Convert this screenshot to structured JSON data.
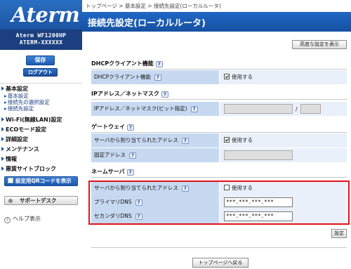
{
  "sidebar": {
    "logo": "Aterm",
    "model": "Aterm WF1200HP",
    "device_id": "ATERM-XXXXXX",
    "save_label": "保存",
    "logout_label": "ログアウト",
    "nav": {
      "basic": "基本設定",
      "basic_sub": [
        "基本設定",
        "接続先の選択設定",
        "接続先設定"
      ],
      "wifi": "Wi-Fi(無線LAN)設定",
      "eco": "ECOモード設定",
      "detail": "詳細設定",
      "maintenance": "メンテナンス",
      "info": "情報",
      "malicious": "悪質サイトブロック"
    },
    "qr_label": "設定用QRコードを表示",
    "support_label": "サポートデスク",
    "help_label": "ヘルプ表示"
  },
  "header": {
    "breadcrumb": "トップページ > 基本設定 > 接続先設定(ローカルルータ)",
    "title": "接続先設定(ローカルルータ)",
    "advanced_label": "高度な設定を表示"
  },
  "sections": {
    "dhcp": {
      "title": "DHCPクライアント機能",
      "row_label": "DHCPクライアント機能",
      "checkbox_label": "使用する",
      "checked": true
    },
    "ip": {
      "title": "IPアドレス／ネットマスク",
      "row_label": "IPアドレス／ネットマスク(ビット指定)",
      "separator": "/"
    },
    "gateway": {
      "title": "ゲートウェイ",
      "auto_label": "サーバから割り当てられたアドレス",
      "auto_checkbox": "使用する",
      "auto_checked": true,
      "fixed_label": "固定アドレス"
    },
    "nameserver": {
      "title": "ネームサーバ",
      "auto_label": "サーバから割り当てられたアドレス",
      "auto_checkbox": "使用する",
      "auto_checked": false,
      "primary_label": "プライマリDNS",
      "primary_value": "***.***.***.***",
      "secondary_label": "セカンダリDNS",
      "secondary_value": "***.***.***.***"
    }
  },
  "help_glyph": "?",
  "set_label": "設定",
  "top_page_label": "トップページへ戻る",
  "colors": {
    "brand_blue": "#1f67c4",
    "label_bg": "#c7d9f1",
    "value_bg": "#e9f0fa",
    "highlight": "#e0131b"
  }
}
